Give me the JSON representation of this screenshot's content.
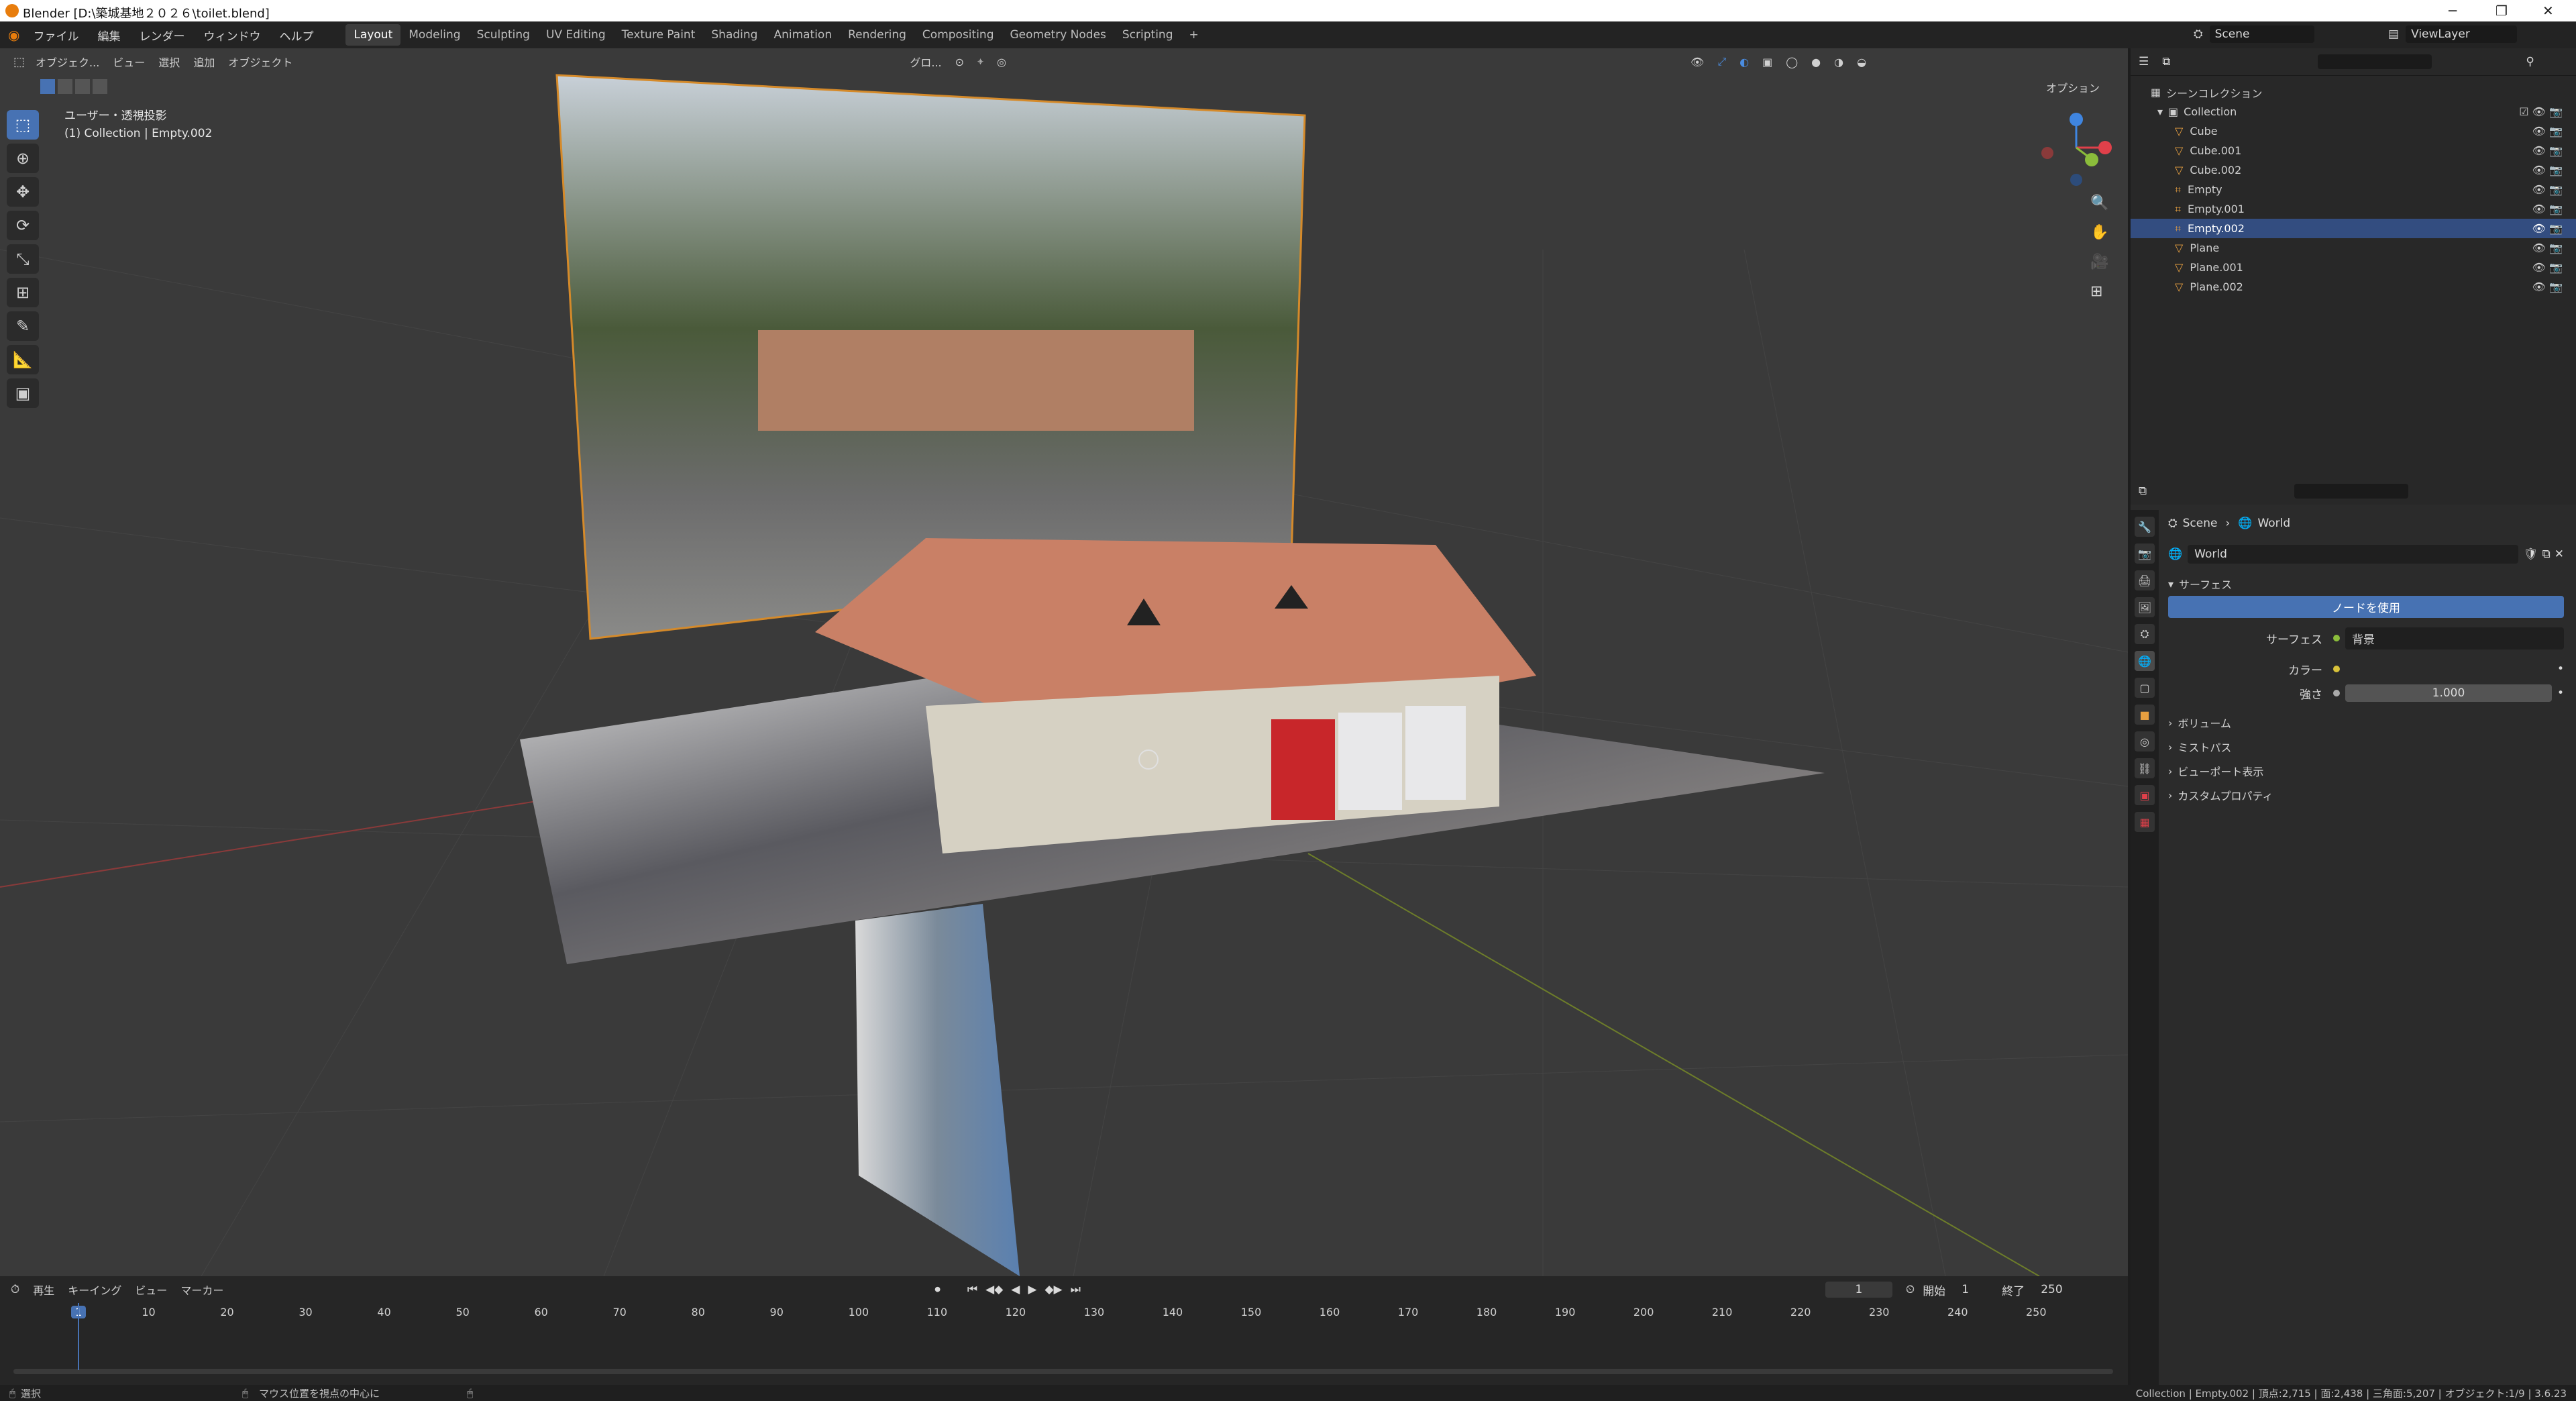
{
  "window": {
    "title": "Blender [D:\\築城基地２０２６\\toilet.blend]",
    "controls": [
      "─",
      "❐",
      "✕"
    ]
  },
  "menu": [
    "ファイル",
    "編集",
    "レンダー",
    "ウィンドウ",
    "ヘルプ"
  ],
  "workspaces": [
    "Layout",
    "Modeling",
    "Sculpting",
    "UV Editing",
    "Texture Paint",
    "Shading",
    "Animation",
    "Rendering",
    "Compositing",
    "Geometry Nodes",
    "Scripting"
  ],
  "active_workspace": "Layout",
  "scene_field": "Scene",
  "viewlayer_field": "ViewLayer",
  "viewport": {
    "mode": "オブジェク...",
    "menus": [
      "ビュー",
      "選択",
      "追加",
      "オブジェクト"
    ],
    "transform": "グロ...",
    "options": "オプション",
    "info_line1": "ユーザー・透視投影",
    "info_line2": "(1) Collection | Empty.002"
  },
  "outliner": {
    "scene_collection": "シーンコレクション",
    "collection": "Collection",
    "items": [
      {
        "name": "Cube",
        "selected": false
      },
      {
        "name": "Cube.001",
        "selected": false
      },
      {
        "name": "Cube.002",
        "selected": false
      },
      {
        "name": "Empty",
        "selected": false
      },
      {
        "name": "Empty.001",
        "selected": false
      },
      {
        "name": "Empty.002",
        "selected": true
      },
      {
        "name": "Plane",
        "selected": false
      },
      {
        "name": "Plane.001",
        "selected": false
      },
      {
        "name": "Plane.002",
        "selected": false
      }
    ]
  },
  "properties": {
    "breadcrumb_scene": "Scene",
    "breadcrumb_world": "World",
    "world_name": "World",
    "surface_panel": "サーフェス",
    "use_nodes_btn": "ノードを使用",
    "surface_label": "サーフェス",
    "surface_value": "背景",
    "color_label": "カラー",
    "strength_label": "強さ",
    "strength_value": "1.000",
    "collapsed_panels": [
      "ボリューム",
      "ミストパス",
      "ビューポート表示",
      "カスタムプロパティ"
    ]
  },
  "timeline": {
    "menus": [
      "再生",
      "キーイング",
      "ビュー",
      "マーカー"
    ],
    "current_frame": "1",
    "start_label": "開始",
    "start_value": "1",
    "end_label": "終了",
    "end_value": "250",
    "ticks": [
      "1",
      "10",
      "20",
      "30",
      "40",
      "50",
      "60",
      "70",
      "80",
      "90",
      "100",
      "110",
      "120",
      "130",
      "140",
      "150",
      "160",
      "170",
      "180",
      "190",
      "200",
      "210",
      "220",
      "230",
      "240",
      "250"
    ]
  },
  "status": {
    "left": "選択",
    "middle": "マウス位置を視点の中心に",
    "right": "Collection | Empty.002 | 頂点:2,715 | 面:2,438 | 三角面:5,207 | オブジェクト:1/9 | 3.6.23"
  },
  "colors": {
    "accent": "#4772b3",
    "selected_row": "#334d80",
    "gizmo_x": "#e0404a",
    "gizmo_y": "#8bbd3b",
    "gizmo_z": "#3f85e0"
  }
}
